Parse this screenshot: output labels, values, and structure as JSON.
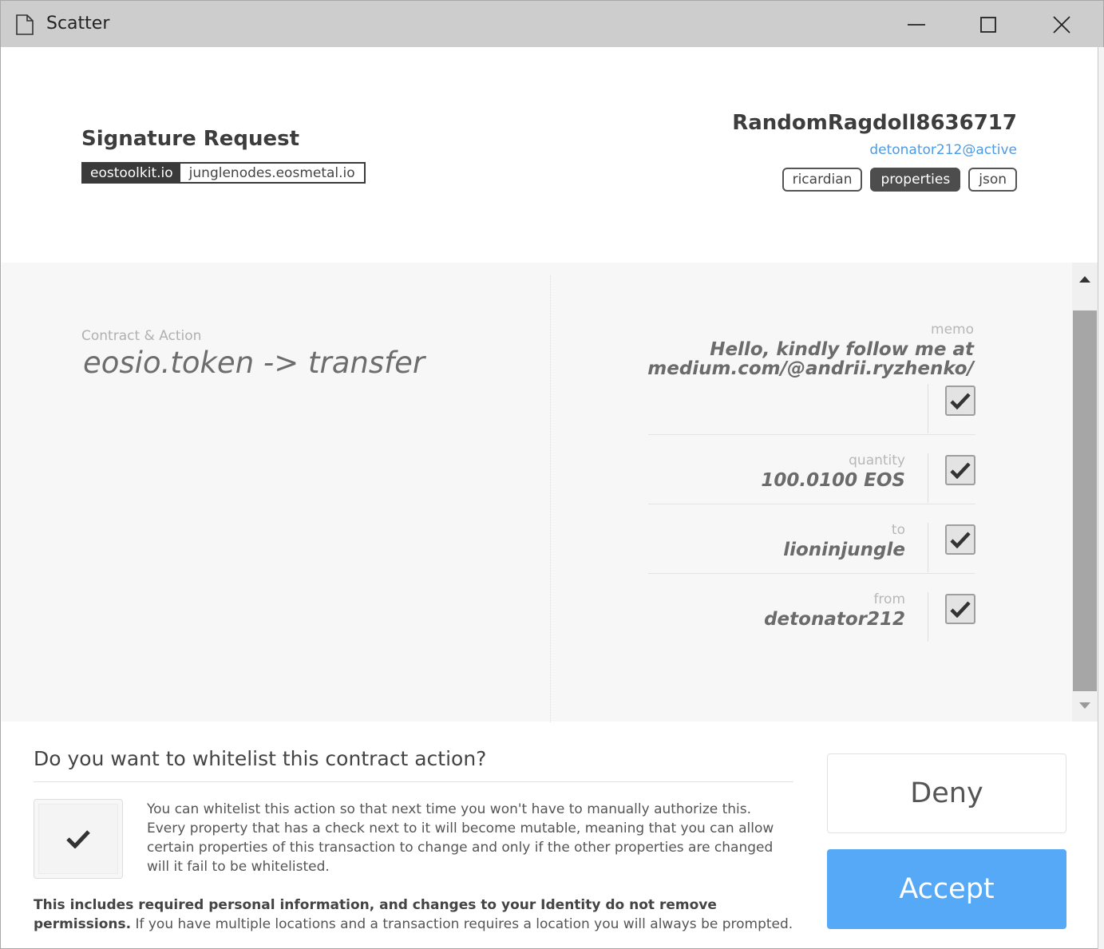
{
  "window": {
    "title": "Scatter"
  },
  "header": {
    "title": "Signature Request",
    "origin": "eostoolkit.io",
    "network": "junglenodes.eosmetal.io",
    "identity_name": "RandomRagdoll8636717",
    "account": "detonator212@active",
    "view_tabs": [
      {
        "label": "ricardian",
        "active": false
      },
      {
        "label": "properties",
        "active": true
      },
      {
        "label": "json",
        "active": false
      }
    ]
  },
  "action": {
    "label": "Contract & Action",
    "value": "eosio.token -> transfer"
  },
  "properties": [
    {
      "label": "memo",
      "value_line1": "Hello, kindly follow me at",
      "value_line2": "medium.com/@andrii.ryzhenko/",
      "checked": true
    },
    {
      "label": "quantity",
      "value": "100.0100 EOS",
      "checked": true
    },
    {
      "label": "to",
      "value": "lioninjungle",
      "checked": true
    },
    {
      "label": "from",
      "value": "detonator212",
      "checked": true
    }
  ],
  "whitelist": {
    "question": "Do you want to whitelist this contract action?",
    "checked": true,
    "description": "You can whitelist this action so that next time you won't have to manually authorize this. Every property that has a check next to it will become mutable, meaning that you can allow certain properties of this transaction to change and only if the other properties are changed will it fail to be whitelisted.",
    "note_bold": "This includes required personal information, and changes to your Identity do not remove permissions.",
    "note_rest": " If you have multiple locations and a transaction requires a location you will always be prompted."
  },
  "buttons": {
    "deny": "Deny",
    "accept": "Accept"
  },
  "colors": {
    "accent": "#55a9f6",
    "link": "#4a9be8",
    "dark_tag": "#3a3a3a"
  }
}
